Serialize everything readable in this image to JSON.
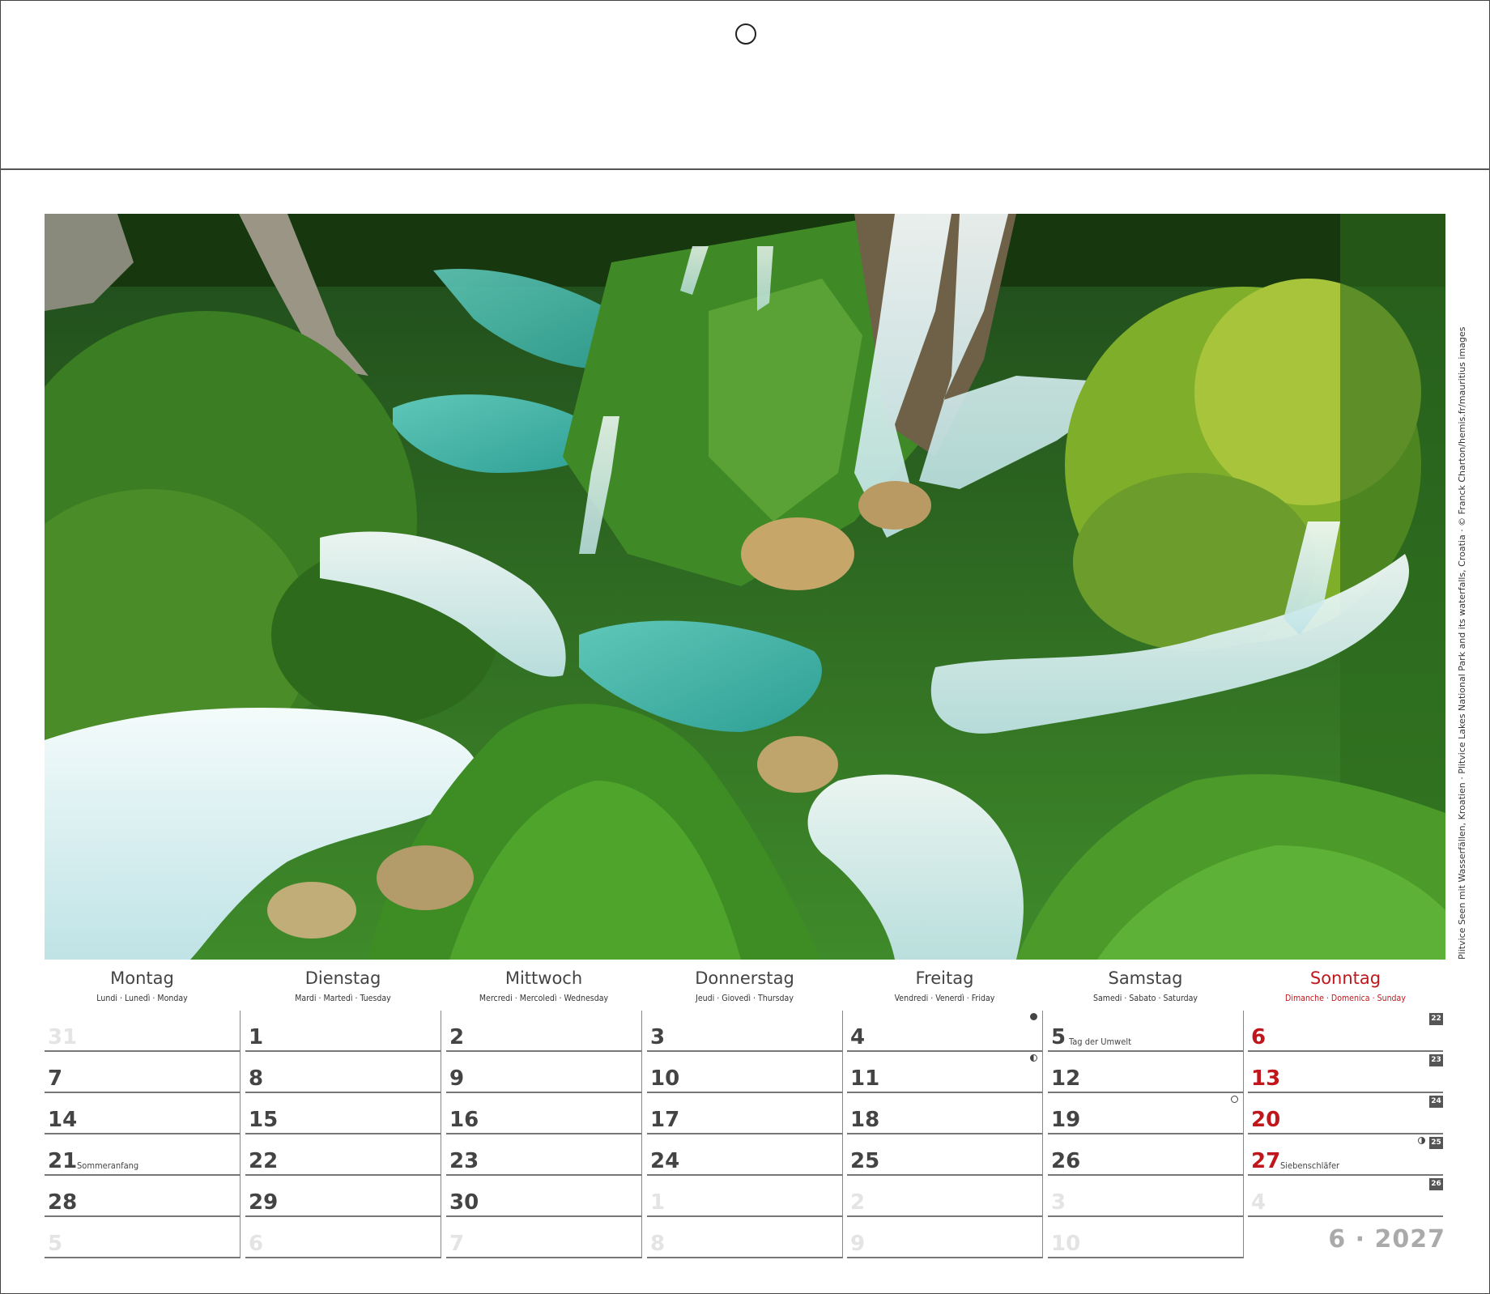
{
  "photo": {
    "alt": "Plitvice waterfalls in lush green forest",
    "credit": "Plitvice Seen mit Wasserfällen, Kroatien · Plitvice Lakes National Park and its waterfalls, Croatia · © Franck Charton/hemis.fr/mauritius images"
  },
  "weekdays": [
    {
      "name": "Montag",
      "sub": "Lundi · Lunedì · Monday"
    },
    {
      "name": "Dienstag",
      "sub": "Mardi · Martedì · Tuesday"
    },
    {
      "name": "Mittwoch",
      "sub": "Mercredi · Mercoledì · Wednesday"
    },
    {
      "name": "Donnerstag",
      "sub": "Jeudi · Giovedì · Thursday"
    },
    {
      "name": "Freitag",
      "sub": "Vendredi · Venerdì · Friday"
    },
    {
      "name": "Samstag",
      "sub": "Samedi · Sabato · Saturday"
    },
    {
      "name": "Sonntag",
      "sub": "Dimanche · Domenica · Sunday"
    }
  ],
  "weeks": [
    {
      "kw": "22",
      "days": [
        {
          "n": "31",
          "dim": true
        },
        {
          "n": "1"
        },
        {
          "n": "2"
        },
        {
          "n": "3"
        },
        {
          "n": "4",
          "moon": "new"
        },
        {
          "n": "5",
          "note": "Tag der Umwelt"
        },
        {
          "n": "6"
        }
      ]
    },
    {
      "kw": "23",
      "days": [
        {
          "n": "7"
        },
        {
          "n": "8"
        },
        {
          "n": "9"
        },
        {
          "n": "10"
        },
        {
          "n": "11",
          "moon": "half-left"
        },
        {
          "n": "12"
        },
        {
          "n": "13"
        }
      ]
    },
    {
      "kw": "24",
      "days": [
        {
          "n": "14"
        },
        {
          "n": "15"
        },
        {
          "n": "16"
        },
        {
          "n": "17"
        },
        {
          "n": "18"
        },
        {
          "n": "19",
          "moon": "full"
        },
        {
          "n": "20"
        }
      ]
    },
    {
      "kw": "25",
      "days": [
        {
          "n": "21",
          "note": "Sommeranfang"
        },
        {
          "n": "22"
        },
        {
          "n": "23"
        },
        {
          "n": "24"
        },
        {
          "n": "25"
        },
        {
          "n": "26"
        },
        {
          "n": "27",
          "note": "Siebenschläfer",
          "moon": "half-right"
        }
      ]
    },
    {
      "kw": "26",
      "days": [
        {
          "n": "28"
        },
        {
          "n": "29"
        },
        {
          "n": "30"
        },
        {
          "n": "1",
          "dim": true
        },
        {
          "n": "2",
          "dim": true
        },
        {
          "n": "3",
          "dim": true
        },
        {
          "n": "4",
          "dim": true
        }
      ]
    },
    {
      "kw": "",
      "days": [
        {
          "n": "5",
          "dim": true
        },
        {
          "n": "6",
          "dim": true
        },
        {
          "n": "7",
          "dim": true
        },
        {
          "n": "8",
          "dim": true
        },
        {
          "n": "9",
          "dim": true
        },
        {
          "n": "10",
          "dim": true
        },
        null
      ]
    }
  ],
  "month_label": "6 · 2027",
  "colors": {
    "sunday": "#c0171d",
    "text": "#404040",
    "dim": "#e4e4e4"
  }
}
